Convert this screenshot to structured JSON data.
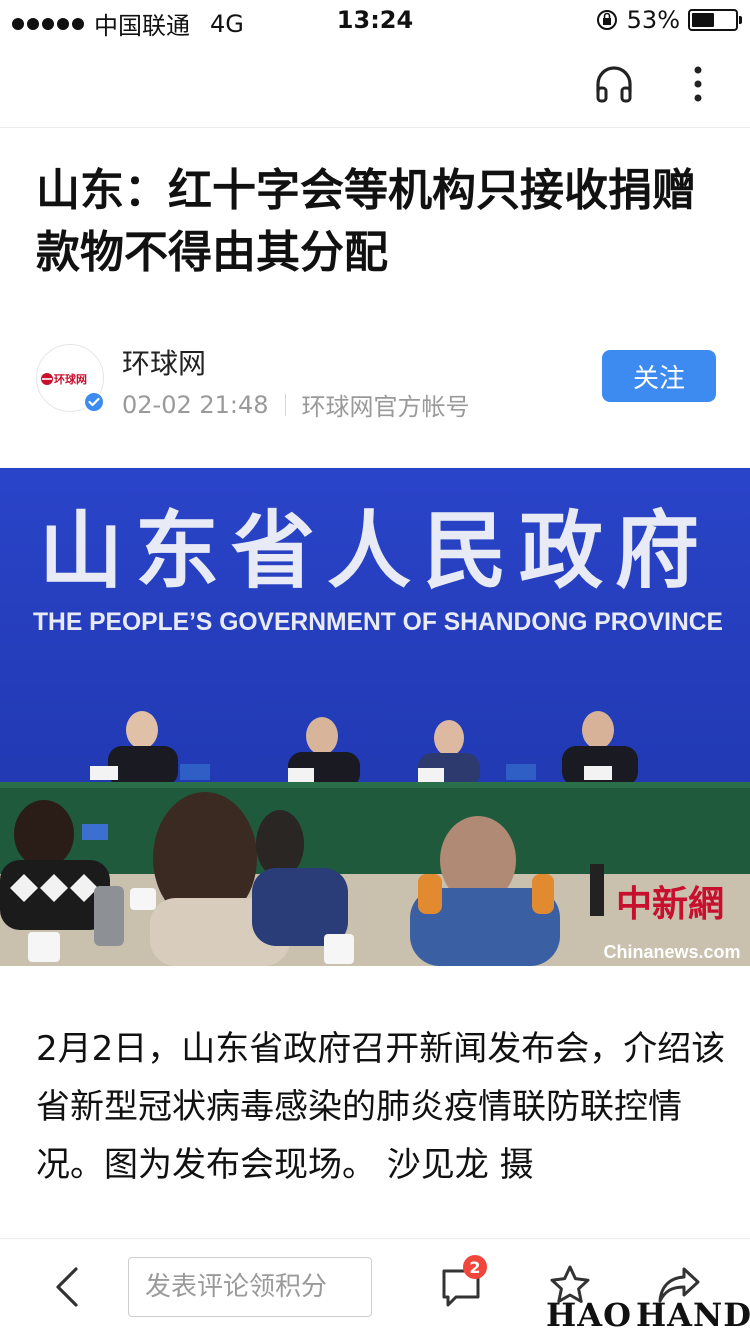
{
  "status_bar": {
    "carrier": "中国联通",
    "network": "4G",
    "time": "13:24",
    "battery": "53%",
    "battery_level": 0.53
  },
  "article": {
    "title": "山东：红十字会等机构只接收捐赠 款物不得由其分配",
    "author": {
      "name": "环球网",
      "avatar_logo_text": "环球网",
      "datetime": "02-02 21:48",
      "account_type": "环球网官方帐号",
      "follow_label": "关注"
    },
    "photo": {
      "banner_cn": "山东省人民政府",
      "banner_en": "THE PEOPLE’S GOVERNMENT OF SHANDONG PROVINCE",
      "watermark_cn": "中新網",
      "watermark_en": "Chinanews.com"
    },
    "caption": "2月2日，山东省政府召开新闻发布会，介绍该省新型冠状病毒感染的肺炎疫情联防联控情况。图为发布会现场。 沙见龙 摄"
  },
  "bottom_bar": {
    "comment_placeholder": "发表评论领积分",
    "comment_count": "2",
    "icons": [
      "back-icon",
      "comments-icon",
      "star-icon",
      "share-icon"
    ]
  },
  "watermark": {
    "left": "HAO",
    "right": "HAND"
  },
  "colors": {
    "accent": "#3d8bf0",
    "badge": "#f0463c",
    "backdrop_blue": "#2038b8",
    "table_green": "#1f5a3c"
  }
}
